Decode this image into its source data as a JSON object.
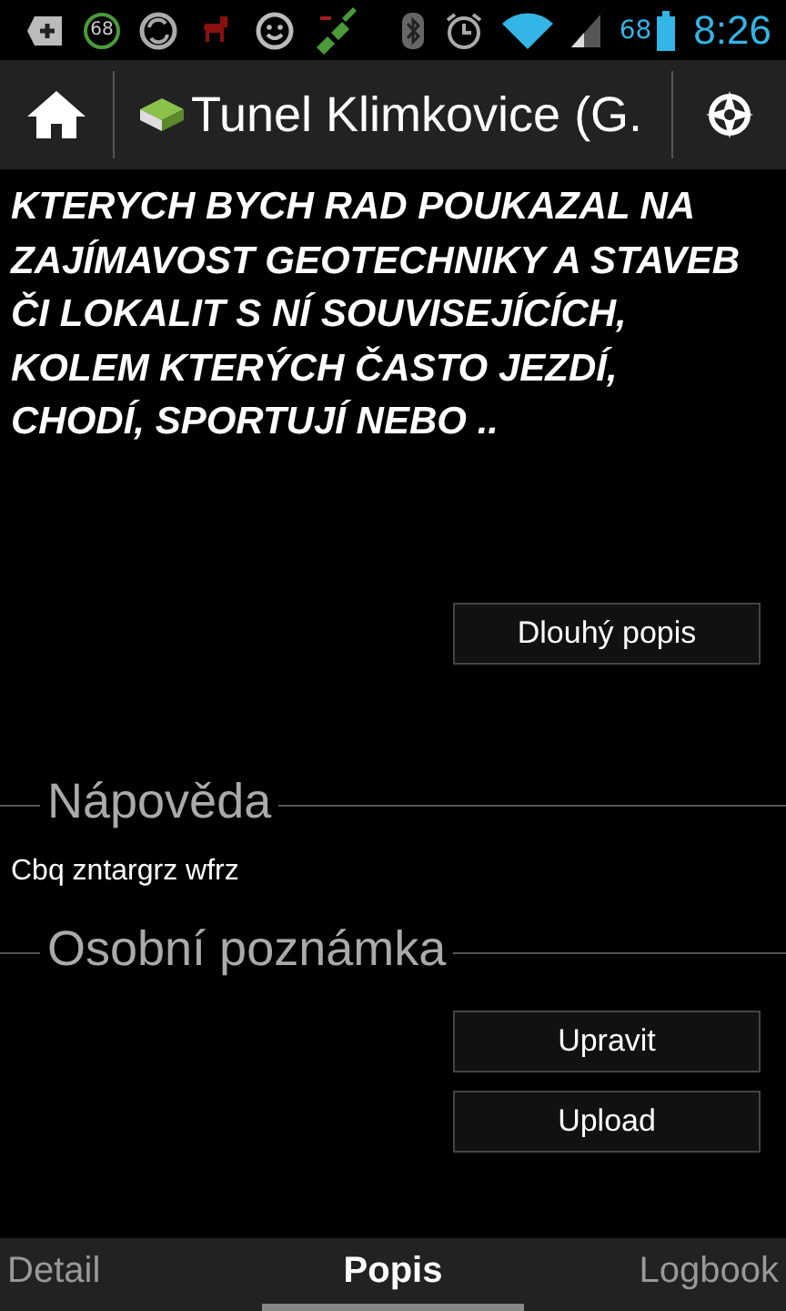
{
  "status_bar": {
    "notification_badge": "68",
    "battery_level_text": "68",
    "time": "8:26"
  },
  "action_bar": {
    "title": "Tunel Klimkovice (G."
  },
  "description": {
    "text": "KTERYCH BYCH RAD POUKAZAL NA ZAJÍMAVOST GEOTECHNIKY A STAVEB ČI LOKALIT S NÍ SOUVISEJÍCÍCH, KOLEM KTERÝCH ČASTO JEZDÍ, CHODÍ, SPORTUJÍ NEBO ..",
    "button": "Dlouhý popis"
  },
  "hint": {
    "heading": "Nápověda",
    "text": "Cbq zntargrz wfrz"
  },
  "note": {
    "heading": "Osobní poznámka",
    "buttons": [
      "Upravit",
      "Upload"
    ]
  },
  "tabs": [
    {
      "label": "Detail",
      "selected": false
    },
    {
      "label": "Popis",
      "selected": true
    },
    {
      "label": "Logbook",
      "selected": false
    }
  ]
}
